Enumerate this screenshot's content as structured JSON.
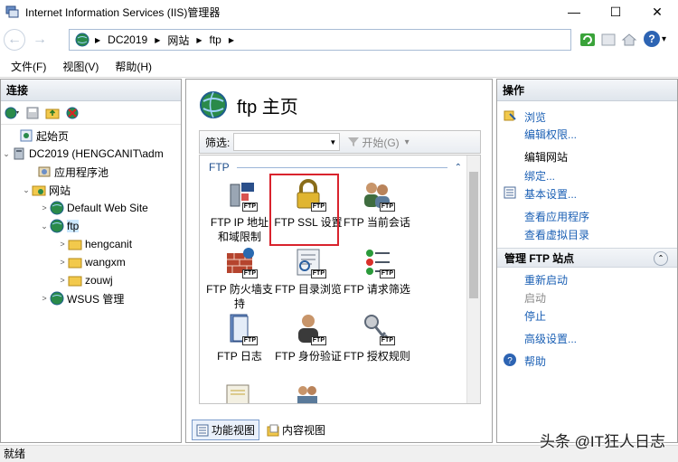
{
  "window": {
    "title": "Internet Information Services (IIS)管理器",
    "minimize": "—",
    "maximize": "☐",
    "close": "✕"
  },
  "address": {
    "crumbs": [
      "DC2019",
      "网站",
      "ftp"
    ],
    "sep": "▶",
    "back": "←",
    "forward": "→",
    "help": "?",
    "help_dropdown": "▾"
  },
  "menu": [
    "文件(F)",
    "视图(V)",
    "帮助(H)"
  ],
  "connections": {
    "header": "连接",
    "tree": [
      {
        "label": "起始页",
        "exp": ""
      },
      {
        "label": "DC2019 (HENGCANIT\\adm",
        "exp": "⌄"
      },
      {
        "label": "应用程序池",
        "exp": ""
      },
      {
        "label": "网站",
        "exp": "⌄"
      },
      {
        "label": "Default Web Site",
        "exp": ">"
      },
      {
        "label": "ftp",
        "exp": "⌄"
      },
      {
        "label": "hengcanit",
        "exp": ">"
      },
      {
        "label": "wangxm",
        "exp": ">"
      },
      {
        "label": "zouwj",
        "exp": ">"
      },
      {
        "label": "WSUS 管理",
        "exp": ">"
      }
    ]
  },
  "center": {
    "title": "ftp 主页",
    "filter_label": "筛选:",
    "filter_arrow": "▼",
    "start_label": "开始(G)",
    "start_arrow": "▾",
    "section": "FTP",
    "section_toggle": "⌃",
    "ftp_badge": "FTP",
    "features": [
      {
        "label": "FTP IP 地址和域限制"
      },
      {
        "label": "FTP SSL 设置"
      },
      {
        "label": "FTP 当前会话"
      },
      {
        "label": "FTP 防火墙支持"
      },
      {
        "label": "FTP 目录浏览"
      },
      {
        "label": "FTP 请求筛选"
      },
      {
        "label": "FTP 日志"
      },
      {
        "label": "FTP 身份验证"
      },
      {
        "label": "FTP 授权规则"
      }
    ],
    "tabs": {
      "feature_view": "功能视图",
      "content_view": "内容视图"
    }
  },
  "actions": {
    "header": "操作",
    "items": [
      "浏览",
      "编辑权限...",
      "编辑网站",
      "绑定...",
      "基本设置...",
      "查看应用程序",
      "查看虚拟目录"
    ],
    "manage_header": "管理 FTP 站点",
    "manage_toggle": "⌃",
    "manage_items": [
      "重新启动",
      "启动",
      "停止",
      "高级设置...",
      "帮助"
    ]
  },
  "status": {
    "text": "就绪"
  },
  "watermark": "头条 @IT狂人日志"
}
